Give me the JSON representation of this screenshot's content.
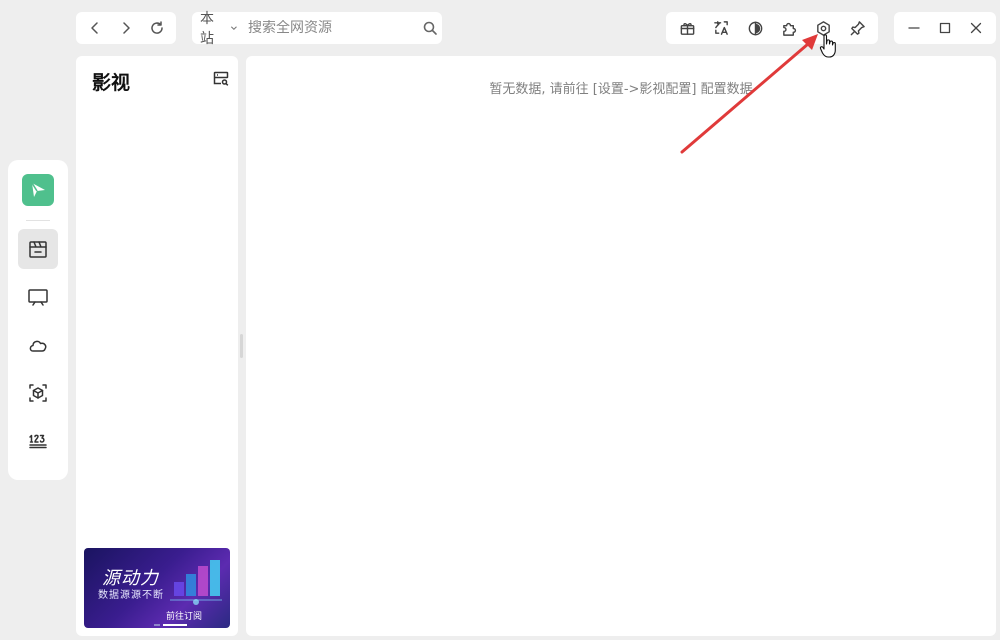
{
  "search": {
    "scope_label": "本站",
    "placeholder": "搜索全网资源"
  },
  "sidebar": {
    "title": "影视",
    "banner": {
      "title": "源动力",
      "subtitle": "数据源源不断",
      "cta": "前往订阅"
    }
  },
  "main": {
    "empty_message": "暂无数据, 请前往 [设置->影视配置] 配置数据"
  },
  "icons": {
    "nav": [
      "chevron-left-icon",
      "chevron-right-icon",
      "refresh-icon"
    ],
    "tools": [
      "gift-icon",
      "translate-icon",
      "theme-icon",
      "puzzle-icon",
      "settings-icon",
      "pin-icon"
    ],
    "window": [
      "minimize-icon",
      "maximize-icon",
      "close-icon"
    ],
    "rail": [
      "film-icon",
      "tv-icon",
      "cloud-icon",
      "cube-icon",
      "number-icon"
    ]
  },
  "colors": {
    "logo": "#4fc08d",
    "annotation_arrow": "#e03a3a",
    "background": "#eeeeee"
  }
}
